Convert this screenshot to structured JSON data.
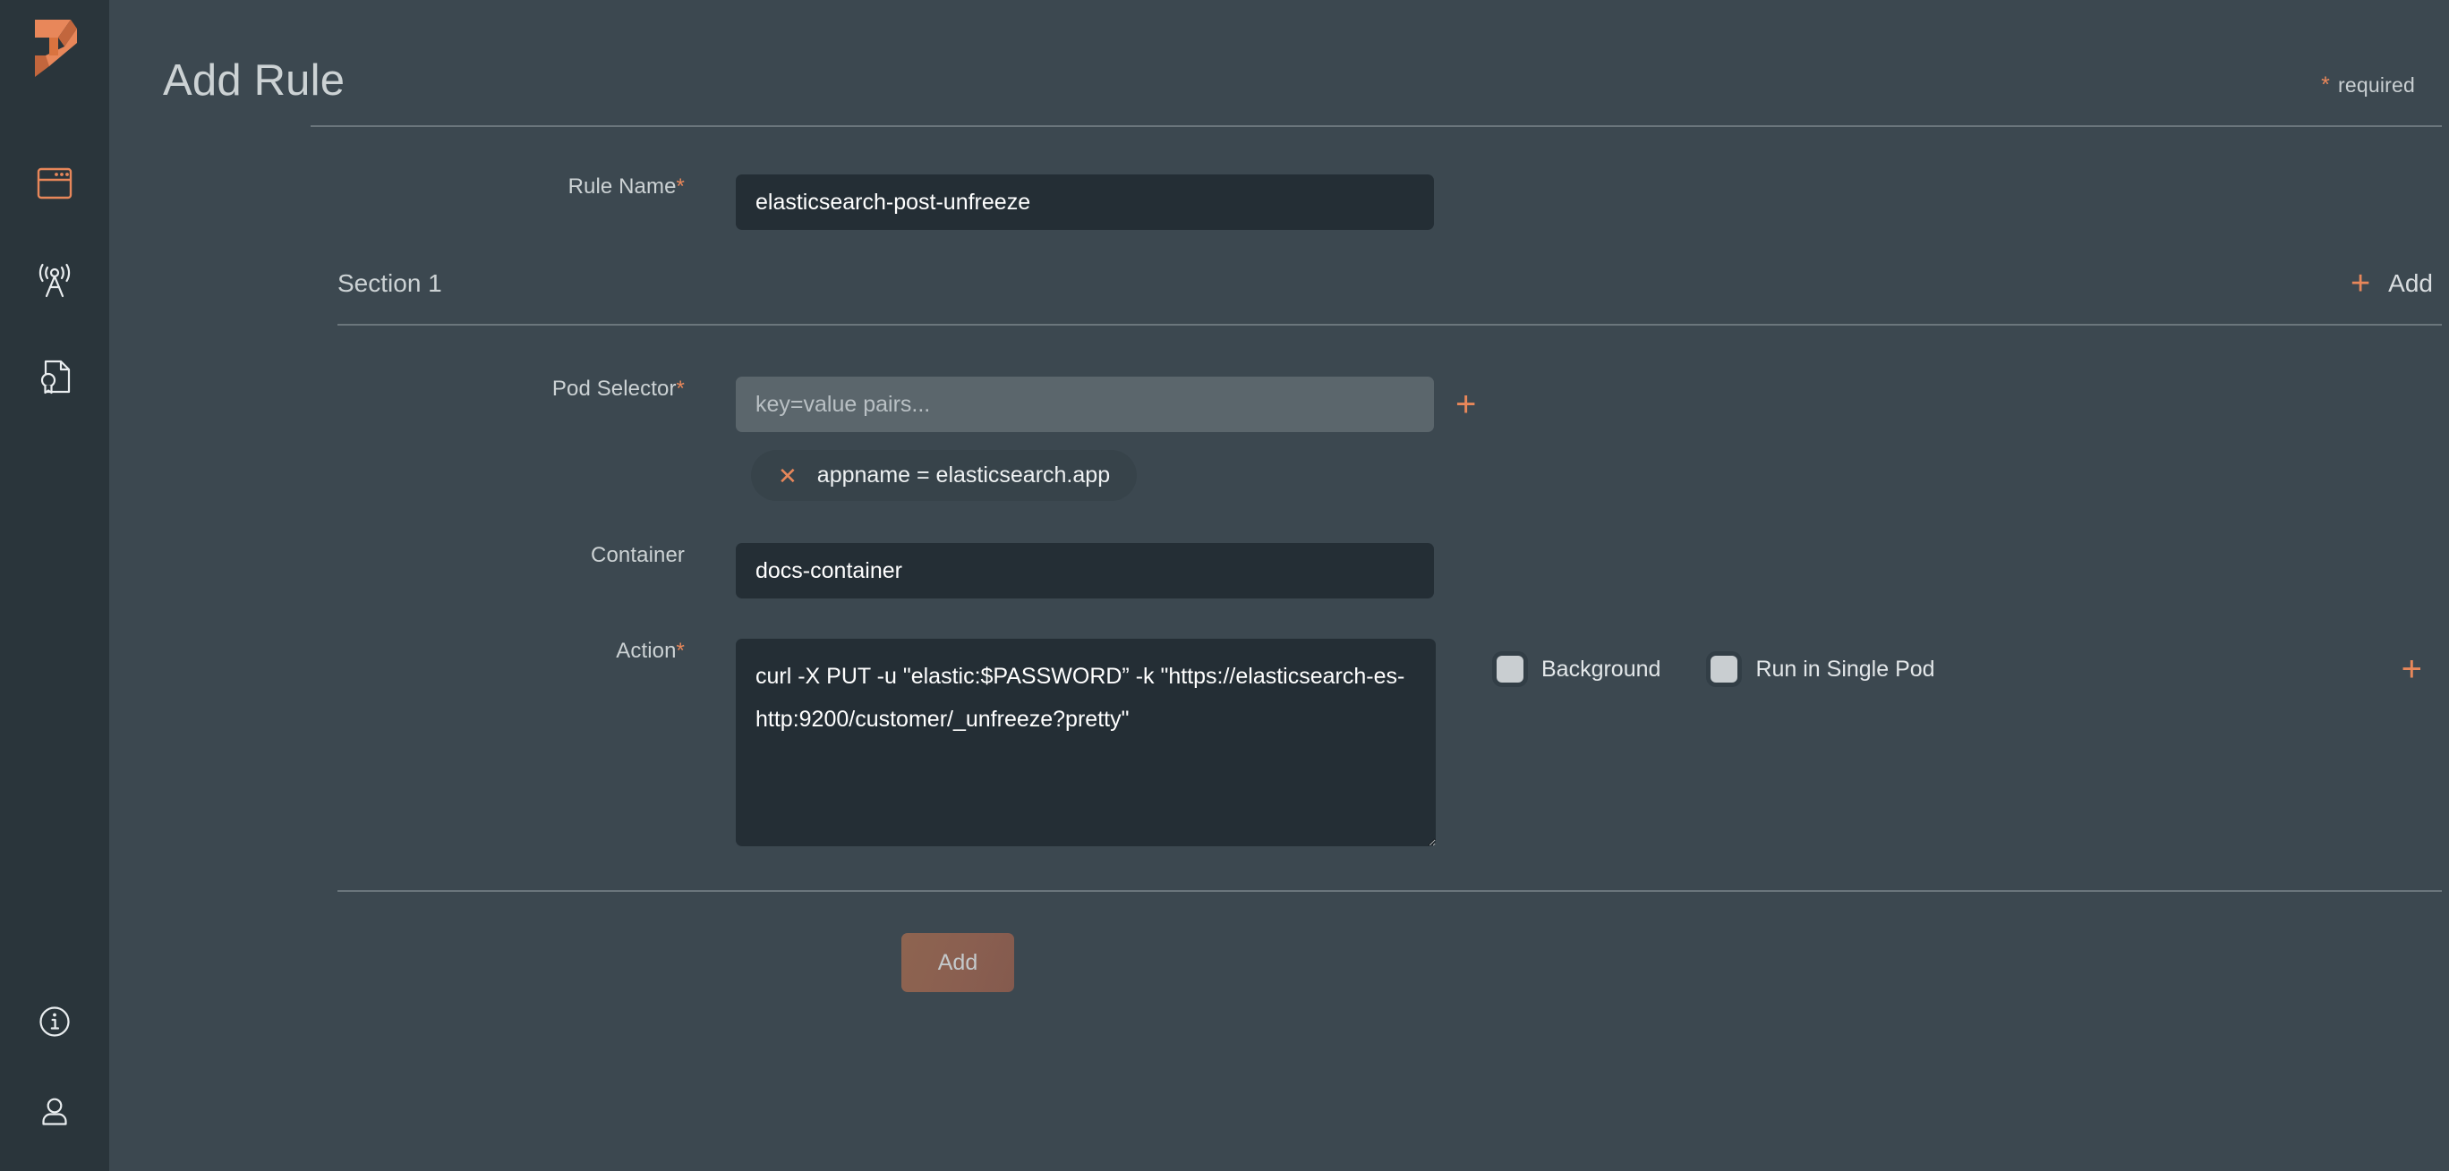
{
  "sidebar": {
    "logo": "peritoneum-logo",
    "items": [
      {
        "name": "browser-window-icon",
        "label": "Dashboard",
        "active": true
      },
      {
        "name": "broadcast-tower-icon",
        "label": "Network",
        "active": false
      },
      {
        "name": "certificate-document-icon",
        "label": "Certificates",
        "active": false
      }
    ],
    "bottom_items": [
      {
        "name": "info-circle-icon",
        "label": "Info"
      },
      {
        "name": "user-account-icon",
        "label": "Account"
      }
    ]
  },
  "header": {
    "title": "Add Rule",
    "required_star": "*",
    "required_label": "required"
  },
  "form": {
    "rule_name": {
      "label": "Rule Name",
      "required_marker": "*",
      "value": "elasticsearch-post-unfreeze",
      "placeholder": ""
    },
    "section": {
      "title": "Section 1",
      "add_label": "Add",
      "add_plus": "+"
    },
    "pod_selector": {
      "label": "Pod Selector",
      "required_marker": "*",
      "value": "",
      "placeholder": "key=value pairs...",
      "add_plus": "+",
      "chips": [
        {
          "remove_icon": "✕",
          "text": "appname = elasticsearch.app"
        }
      ]
    },
    "container": {
      "label": "Container",
      "required_marker": "",
      "value": "docs-container",
      "placeholder": ""
    },
    "action": {
      "label": "Action",
      "required_marker": "*",
      "value": "curl -X PUT -u \"elastic:$PASSWORD” -k \"https://elasticsearch-es-http:9200/customer/_unfreeze?pretty\"",
      "placeholder": "",
      "add_plus": "+",
      "options": [
        {
          "name": "background",
          "label": "Background",
          "checked": false
        },
        {
          "name": "run-in-single-pod",
          "label": "Run in Single Pod",
          "checked": false
        }
      ]
    },
    "submit": {
      "label": "Add"
    }
  },
  "colors": {
    "accent": "#e8875a",
    "sidebar_bg": "#2a353b",
    "page_bg": "#3c4850",
    "input_bg": "#242e35",
    "input_disabled_bg": "#5b666c",
    "chip_bg": "#37434a",
    "divider": "#6b767c",
    "submit_bg": "#8a5f50"
  }
}
